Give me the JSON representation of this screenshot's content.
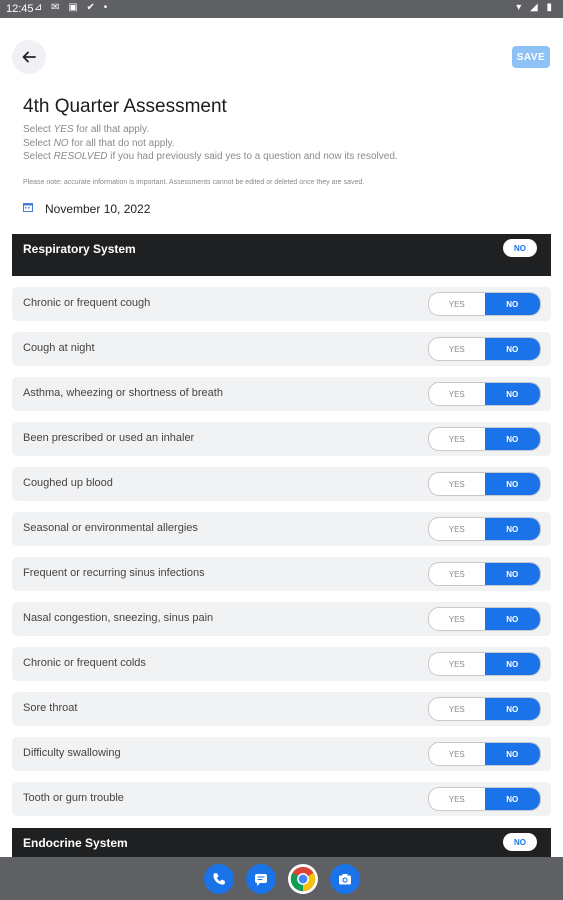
{
  "status_bar": {
    "time": "12:45"
  },
  "header": {
    "save_label": "SAVE"
  },
  "page": {
    "title": "4th Quarter Assessment",
    "instruction_prefix": "Select",
    "instruction_yes_word": "YES",
    "instruction_yes_rest": "for all that apply.",
    "instruction_no_word": "NO",
    "instruction_no_rest": "for all that do not apply.",
    "instruction_resolved_word": "RESOLVED",
    "instruction_resolved_rest": "if you had previously said yes to a question and now its resolved.",
    "note": "Please note: accurate information is important. Assessments cannot be edited or deleted once they are saved.",
    "date": "November 10, 2022"
  },
  "sections": [
    {
      "label": "Respiratory System",
      "toggle": "NO"
    },
    {
      "label": "Endocrine System",
      "toggle": "NO"
    }
  ],
  "toggle_labels": {
    "yes": "YES",
    "no": "NO"
  },
  "questions": [
    {
      "text": "Chronic or frequent cough",
      "selected": "NO"
    },
    {
      "text": "Cough at night",
      "selected": "NO"
    },
    {
      "text": "Asthma, wheezing or shortness of breath",
      "selected": "NO"
    },
    {
      "text": "Been prescribed or used an inhaler",
      "selected": "NO"
    },
    {
      "text": "Coughed up blood",
      "selected": "NO"
    },
    {
      "text": "Seasonal or environmental allergies",
      "selected": "NO"
    },
    {
      "text": "Frequent or recurring sinus infections",
      "selected": "NO"
    },
    {
      "text": "Nasal congestion, sneezing, sinus pain",
      "selected": "NO"
    },
    {
      "text": "Chronic or frequent colds",
      "selected": "NO"
    },
    {
      "text": "Sore throat",
      "selected": "NO"
    },
    {
      "text": "Difficulty swallowing",
      "selected": "NO"
    },
    {
      "text": "Tooth or gum trouble",
      "selected": "NO"
    }
  ],
  "colors": {
    "accent": "#1a73e8",
    "section_bg": "#1f2022",
    "row_bg": "#f1f2f4",
    "save_bg": "#8ec2f6"
  },
  "nav_apps": [
    "phone-icon",
    "messages-icon",
    "chrome-icon",
    "camera-icon"
  ]
}
